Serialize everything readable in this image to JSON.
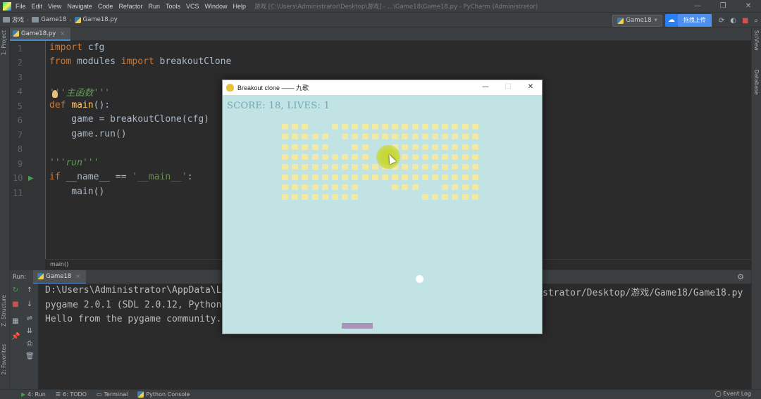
{
  "menubar": {
    "items": [
      "File",
      "Edit",
      "View",
      "Navigate",
      "Code",
      "Refactor",
      "Run",
      "Tools",
      "VCS",
      "Window",
      "Help"
    ],
    "title": "游戏 [C:\\Users\\Administrator\\Desktop\\游戏] - ...\\Game18\\Game18.py - PyCharm (Administrator)",
    "window_controls": [
      "—",
      "❐",
      "✕"
    ]
  },
  "navbar": {
    "crumbs": [
      "游戏",
      "Game18",
      "Game18.py"
    ],
    "run_config": "Game18",
    "baidu_label": "拖拽上传"
  },
  "editor_tab": {
    "label": "Game18.py",
    "close": "×"
  },
  "side_labels": {
    "project": "1: Project",
    "structure": "Z: Structure",
    "favorites": "2: Favorites",
    "scview": "SciView",
    "database": "Database"
  },
  "code": {
    "line_numbers": [
      "1",
      "2",
      "3",
      "4",
      "5",
      "6",
      "7",
      "8",
      "9",
      "10",
      "11"
    ],
    "lines": [
      {
        "kw1": "import",
        "rest": " cfg"
      },
      {
        "kw1": "from",
        "mid": " modules ",
        "kw2": "import",
        "rest": " breakoutClone"
      },
      {
        "doc": "'''主函数'''"
      },
      {
        "kw1": "def",
        "fn": "main",
        "rest": "():"
      },
      {
        "rest": "    game = breakoutClone(cfg)"
      },
      {
        "rest": "    game.run()"
      },
      {
        "doc": "'''run'''"
      },
      {
        "kw1": "if",
        "mid": " __name__ == ",
        "str": "'__main__'",
        "rest": ":"
      },
      {
        "rest": "    main()"
      }
    ],
    "breadcrumb": "main()"
  },
  "run_panel": {
    "label": "Run:",
    "tab": "Game18",
    "output": [
      "D:\\Users\\Administrator\\AppData\\L",
      "strator/Desktop/游戏/Game18/Game18.py",
      "pygame 2.0.1 (SDL 2.0.12, Python",
      "Hello from the pygame community."
    ]
  },
  "statusbar": {
    "items": [
      "4: Run",
      "6: TODO",
      "Terminal",
      "Python Console"
    ],
    "event_log": "Event Log"
  },
  "game_window": {
    "title": "Breakout clone —— 九歌",
    "score_text": "SCORE: 18, LIVES: 1",
    "controls": [
      "—",
      "☐",
      "✕"
    ],
    "brick_color": "#f2e9a4",
    "background_color": "#c2e3e4",
    "paddle_color": "#a795b8"
  }
}
